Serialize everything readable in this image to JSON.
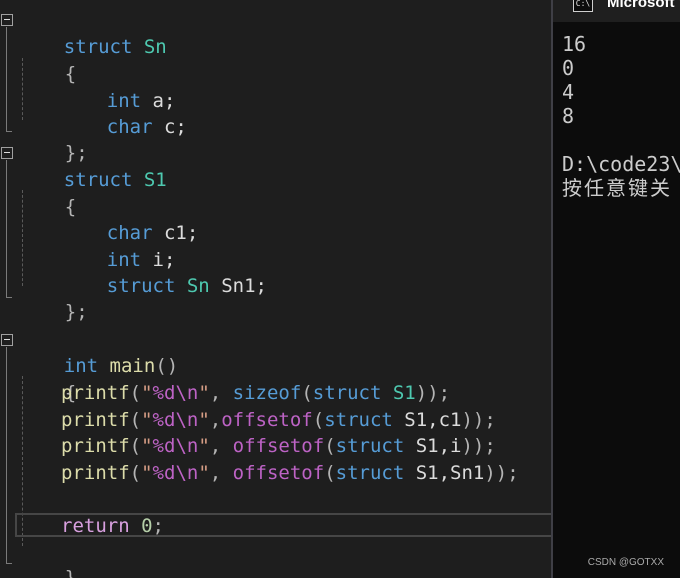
{
  "editor": {
    "sn": {
      "kw_struct": "struct",
      "name": "Sn",
      "open_brace": "{",
      "field1_type": "int",
      "field1_rest": " a;",
      "field2_type": "char",
      "field2_rest": " c;",
      "close": "};"
    },
    "s1": {
      "kw_struct": "struct",
      "name": "S1",
      "open_brace": "{",
      "field1_type": "char",
      "field1_rest": " c1;",
      "field2_type": "int",
      "field2_rest": " i;",
      "field3_struct": "struct",
      "field3_type": "Sn",
      "field3_rest": " Sn1;",
      "close": "};"
    },
    "main": {
      "ret_type": "int",
      "name": "main",
      "parens": "()",
      "open_brace": "{",
      "call1": {
        "fn": "printf",
        "open": "(",
        "str_q1": "\"",
        "fmt": "%d",
        "esc": "\\n",
        "str_q2": "\"",
        "comma": ", ",
        "op": "sizeof",
        "p1": "(",
        "kw": "struct",
        "type": "S1",
        "p2": "));"
      },
      "call2": {
        "fn": "printf",
        "open": "(",
        "str_q1": "\"",
        "fmt": "%d",
        "esc": "\\n",
        "str_q2": "\"",
        "comma": ",",
        "macro": "offsetof",
        "p1": "(",
        "kw": "struct",
        "args": " S1,c1",
        "p2": "));"
      },
      "call3": {
        "fn": "printf",
        "open": "(",
        "str_q1": "\"",
        "fmt": "%d",
        "esc": "\\n",
        "str_q2": "\"",
        "comma": ", ",
        "macro": "offsetof",
        "p1": "(",
        "kw": "struct",
        "args": " S1,i",
        "p2": "));"
      },
      "call4": {
        "fn": "printf",
        "open": "(",
        "str_q1": "\"",
        "fmt": "%d",
        "esc": "\\n",
        "str_q2": "\"",
        "comma": ", ",
        "macro": "offsetof",
        "p1": "(",
        "kw": "struct",
        "args": " S1,Sn1",
        "p2": "));"
      },
      "ret_kw": "return",
      "ret_val": "0",
      "ret_semi": ";",
      "close": "}"
    }
  },
  "console": {
    "title": "Microsoft V",
    "icon_label": "C:\\",
    "outputs": [
      "16",
      "0",
      "4",
      "8"
    ],
    "path_line": "D:\\code23\\",
    "prompt_line": "按任意键关"
  },
  "watermark": "CSDN @GOTXX",
  "colors": {
    "editor_bg": "#1e1e1e",
    "console_bg": "#0c0c0c",
    "keyword": "#569cd6",
    "type": "#4ec9b0",
    "function": "#dcdcaa",
    "string": "#d69d85",
    "macro": "#bd63c5",
    "control": "#d8a0df"
  }
}
